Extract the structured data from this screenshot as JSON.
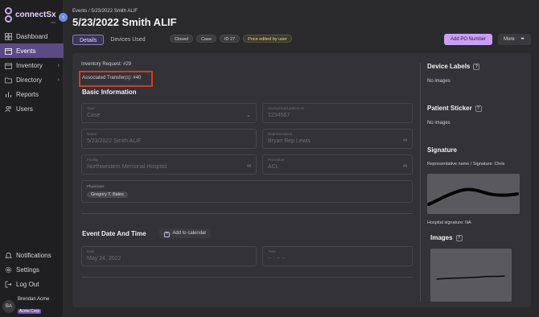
{
  "brand": {
    "name": "connectSx",
    "sub": "SISx"
  },
  "sidebar": {
    "items": [
      {
        "label": "Dashboard",
        "icon": "dashboard-icon"
      },
      {
        "label": "Events",
        "icon": "calendar-icon"
      },
      {
        "label": "Inventory",
        "icon": "box-icon"
      },
      {
        "label": "Directory",
        "icon": "folder-icon"
      },
      {
        "label": "Reports",
        "icon": "chart-icon"
      },
      {
        "label": "Users",
        "icon": "users-icon"
      }
    ],
    "bottom": [
      {
        "label": "Notifications",
        "icon": "bell-icon"
      },
      {
        "label": "Settings",
        "icon": "gear-icon"
      },
      {
        "label": "Log Out",
        "icon": "logout-icon"
      }
    ],
    "user": {
      "initials": "BA",
      "name": "Brendan Acme",
      "org": "Acme Corp"
    }
  },
  "header": {
    "breadcrumb": "Events / 5/23/2022 Smith ALIF",
    "title": "5/23/2022 Smith ALIF",
    "tabs": [
      "Details",
      "Devices Used"
    ],
    "chips": [
      "Closed",
      "Case",
      "ID 27",
      "Price edited by user"
    ],
    "po_button": "Add PO Number",
    "more_button": "More"
  },
  "details": {
    "inventory_request": "Inventory Request:  #29",
    "associated_transfers": "Associated Transfer(s):   #40",
    "basic_info_title": "Basic Information",
    "fields": {
      "type": {
        "label": "Type",
        "value": "Case"
      },
      "patient_id": {
        "label": "Anonymized patient ID",
        "value": "1234567"
      },
      "name": {
        "label": "Name",
        "value": "5/23/2022 Smith ALIF"
      },
      "representative": {
        "label": "Representative",
        "value": "Bryan Rep Lewis"
      },
      "facility": {
        "label": "Facility",
        "value": "Northwestern Memorial Hospital"
      },
      "procedure": {
        "label": "Procedure",
        "value": "ACL"
      },
      "physicians": {
        "label": "Physicians",
        "value": "Gregory T. Bales"
      }
    },
    "event_date_title": "Event Date And Time",
    "add_calendar": "Add to calendar",
    "date": {
      "label": "Date",
      "value": "May 24, 2022"
    },
    "time": {
      "label": "Time",
      "value": "-- : -- --"
    }
  },
  "right": {
    "device_labels": "Device Labels",
    "no_images_1": "No images",
    "patient_sticker": "Patient Sticker",
    "no_images_2": "No images",
    "signature": "Signature",
    "rep_signature": "Representative name / Signature: Chris",
    "hospital_signature": "Hospital signature: NA",
    "images": "Images"
  }
}
